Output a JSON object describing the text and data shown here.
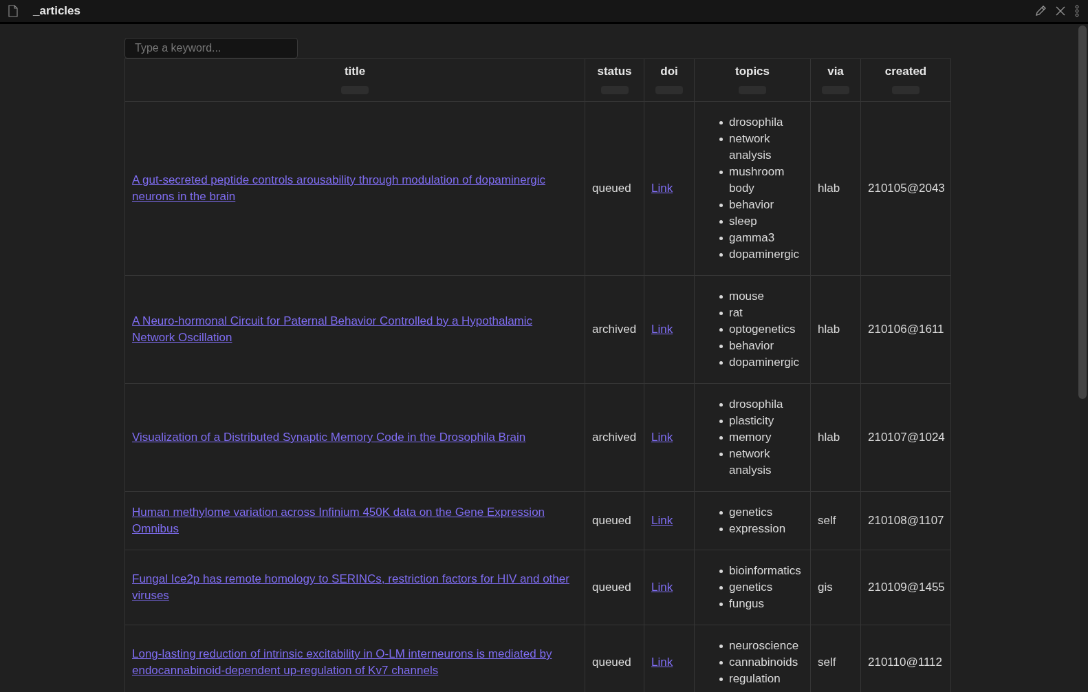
{
  "window": {
    "title": "_articles"
  },
  "search": {
    "placeholder": "Type a keyword..."
  },
  "table": {
    "columns": [
      "title",
      "status",
      "doi",
      "topics",
      "via",
      "created"
    ],
    "rows": [
      {
        "title": "A gut-secreted peptide controls arousability through modulation of dopaminergic neurons in the brain",
        "status": "queued",
        "doi": "Link",
        "topics": [
          "drosophila",
          "network analysis",
          "mushroom body",
          "behavior",
          "sleep",
          "gamma3",
          "dopaminergic"
        ],
        "via": "hlab",
        "created": "210105@2043"
      },
      {
        "title": "A Neuro-hormonal Circuit for Paternal Behavior Controlled by a Hypothalamic Network Oscillation",
        "status": "archived",
        "doi": "Link",
        "topics": [
          "mouse",
          "rat",
          "optogenetics",
          "behavior",
          "dopaminergic"
        ],
        "via": "hlab",
        "created": "210106@1611"
      },
      {
        "title": "Visualization of a Distributed Synaptic Memory Code in the Drosophila Brain",
        "status": "archived",
        "doi": "Link",
        "topics": [
          "drosophila",
          "plasticity",
          "memory",
          "network analysis"
        ],
        "via": "hlab",
        "created": "210107@1024"
      },
      {
        "title": "Human methylome variation across Infinium 450K data on the Gene Expression Omnibus",
        "status": "queued",
        "doi": "Link",
        "topics": [
          "genetics",
          "expression"
        ],
        "via": "self",
        "created": "210108@1107"
      },
      {
        "title": "Fungal Ice2p has remote homology to SERINCs, restriction factors for HIV and other viruses",
        "status": "queued",
        "doi": "Link",
        "topics": [
          "bioinformatics",
          "genetics",
          "fungus"
        ],
        "via": "gis",
        "created": "210109@1455"
      },
      {
        "title": "Long-lasting reduction of intrinsic excitability in O-LM interneurons is mediated by endocannabinoid-dependent up-regulation of Kv7 channels",
        "status": "queued",
        "doi": "Link",
        "topics": [
          "neuroscience",
          "cannabinoids",
          "regulation"
        ],
        "via": "self",
        "created": "210110@1112"
      }
    ]
  }
}
